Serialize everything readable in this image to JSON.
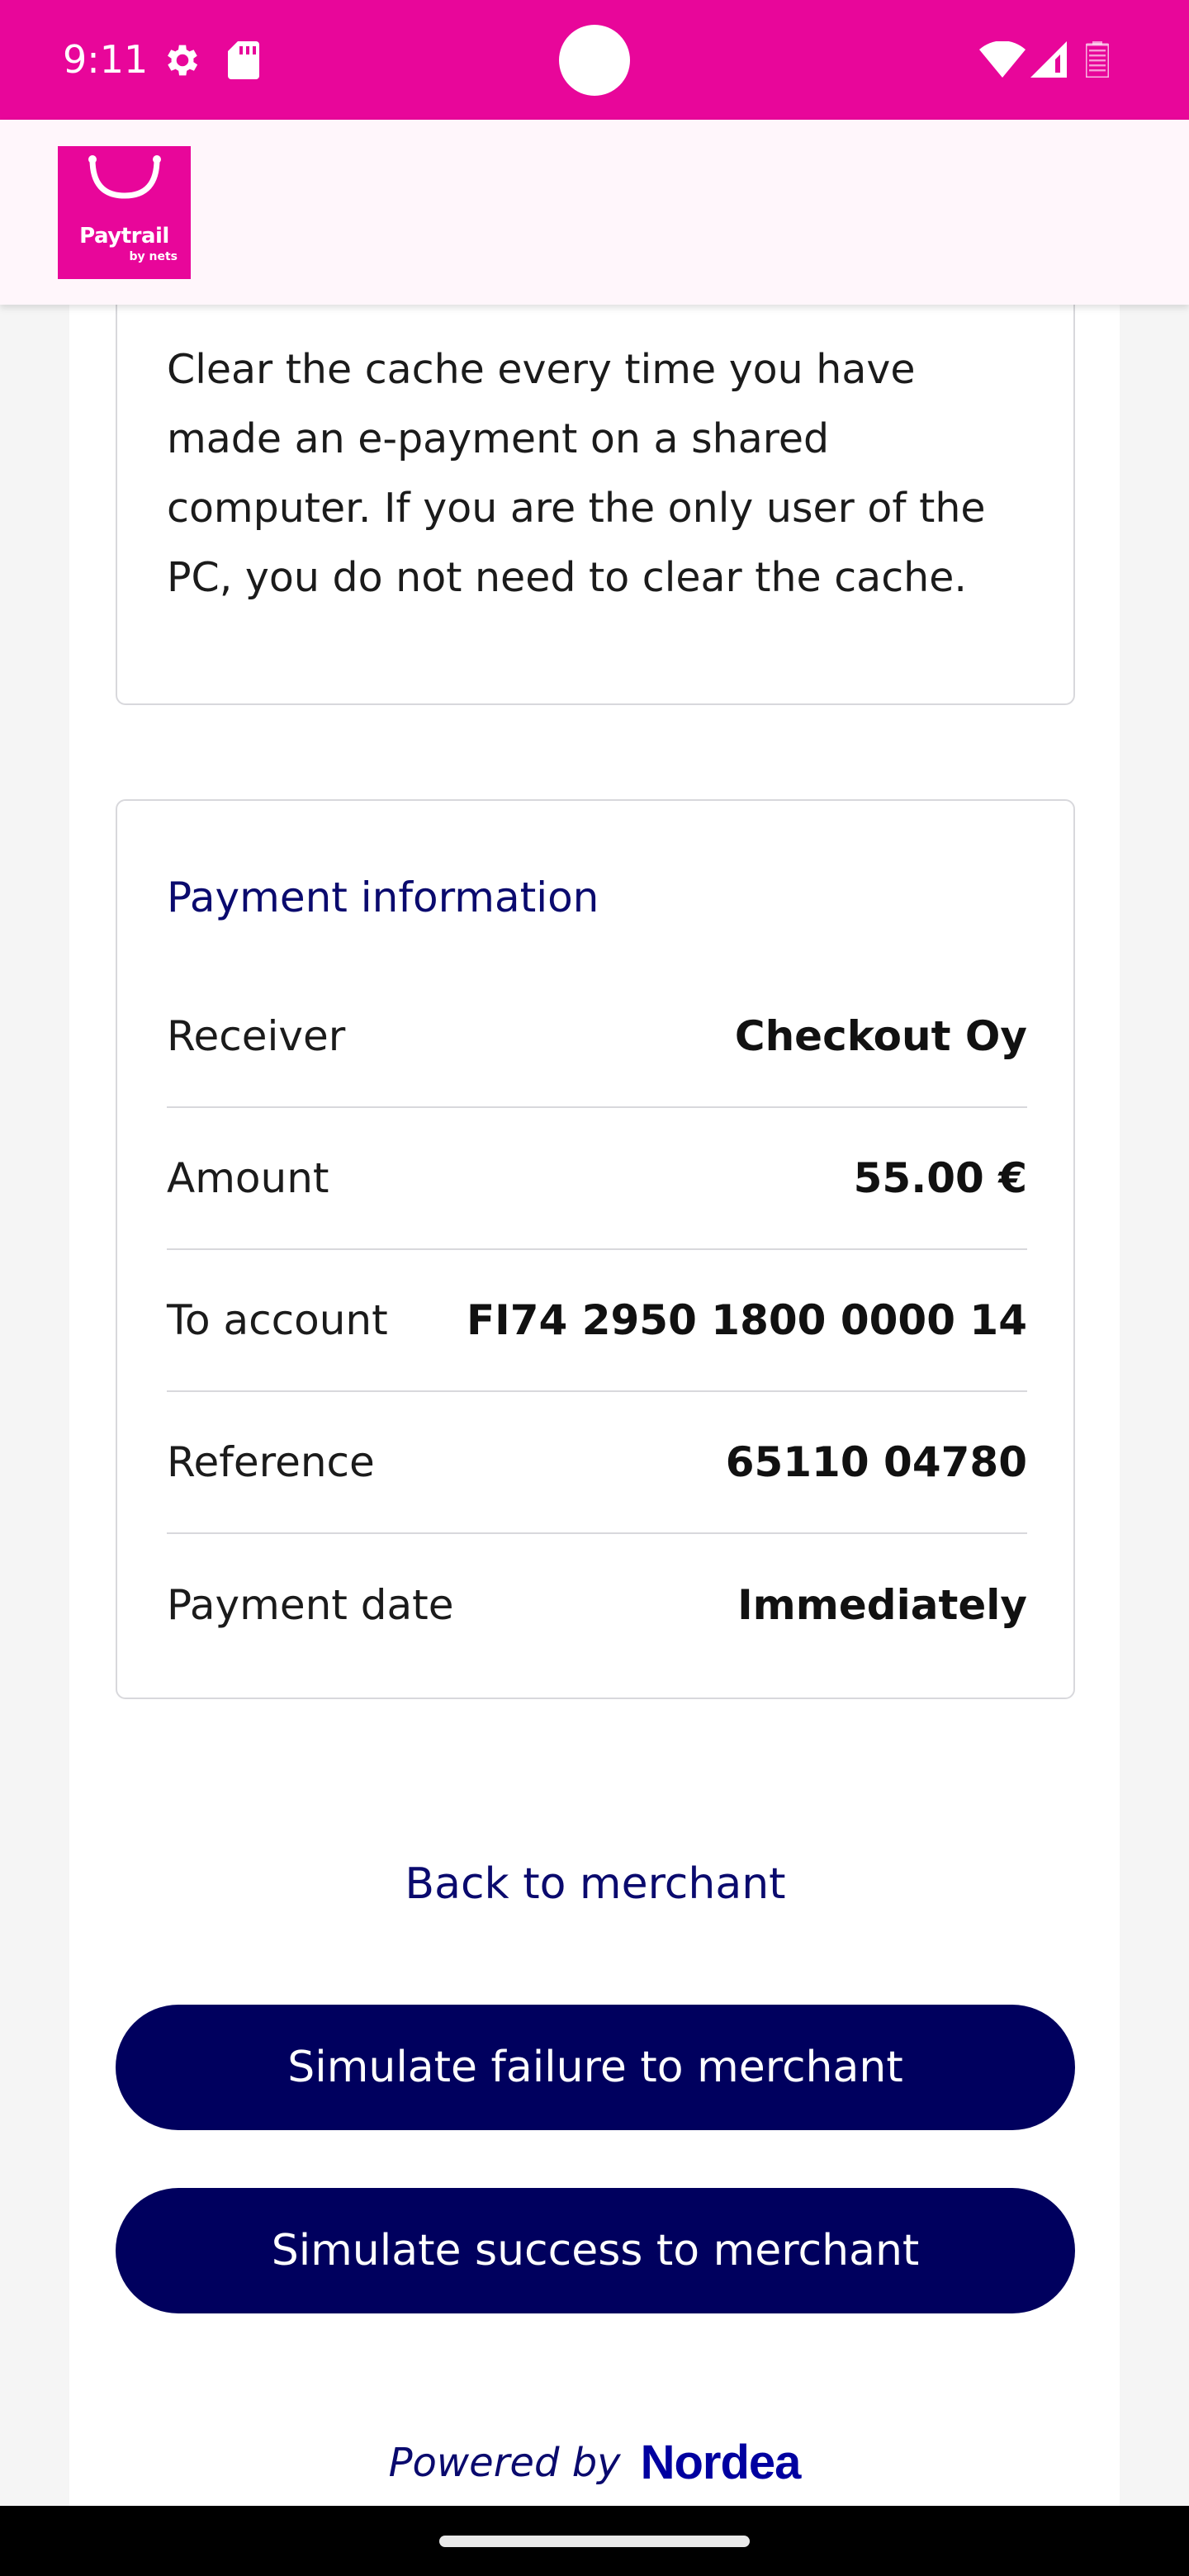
{
  "status_bar": {
    "time": "9:11",
    "icons": [
      "gear-icon",
      "sd-card-icon",
      "wifi-icon",
      "signal-icon",
      "battery-icon"
    ],
    "background": "#e8069a"
  },
  "header": {
    "logo_name": "Paytrail",
    "logo_sub": "by nets",
    "brand_color": "#e8069a"
  },
  "cache_notice": {
    "text": "Clear the cache every time you have made an e-payment on a shared computer. If you are the only user of the PC, you do not need to clear the cache."
  },
  "payment_info": {
    "title": "Payment information",
    "rows": [
      {
        "label": "Receiver",
        "value": "Checkout Oy"
      },
      {
        "label": "Amount",
        "value": "55.00 €"
      },
      {
        "label": "To account",
        "value": "FI74 2950 1800 0000 14"
      },
      {
        "label": "Reference",
        "value": "65110 04780"
      },
      {
        "label": "Payment date",
        "value": "Immediately"
      }
    ]
  },
  "actions": {
    "back_label": "Back to merchant",
    "failure_label": "Simulate failure to merchant",
    "success_label": "Simulate success to merchant",
    "button_color": "#00005e"
  },
  "footer": {
    "powered_by": "Powered by",
    "brand": "Nordea"
  }
}
